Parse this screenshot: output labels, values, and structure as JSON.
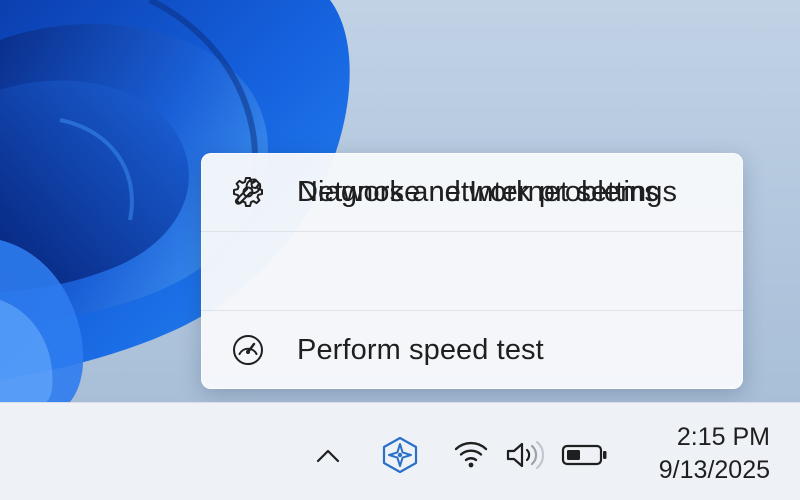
{
  "context_menu": {
    "items": [
      {
        "label": "Diagnose network problems",
        "icon": "wrench-icon"
      },
      {
        "label": "Perform speed test",
        "icon": "speedometer-icon"
      },
      {
        "label": "Network and Internet settings",
        "icon": "gear-icon"
      }
    ]
  },
  "taskbar": {
    "tray_icons": [
      "chevron-up-icon",
      "copilot-icon",
      "wifi-icon",
      "volume-icon",
      "battery-icon"
    ],
    "clock": {
      "time": "2:15 PM",
      "date": "9/13/2025"
    }
  },
  "colors": {
    "wallpaper_blue": "#1565d8",
    "wallpaper_bg": "#b7cbe0",
    "menu_bg": "#f6f8fb",
    "taskbar_bg": "#eef2f7",
    "copilot_accent": "#2a6fc9",
    "text": "#1f1f1f"
  }
}
